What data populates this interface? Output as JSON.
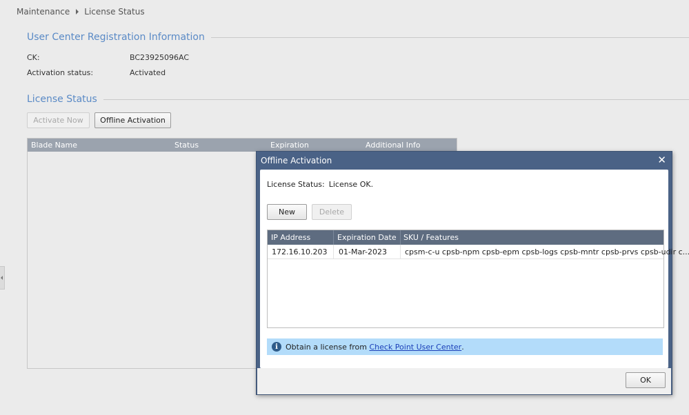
{
  "breadcrumb": {
    "parent": "Maintenance",
    "current": "License Status"
  },
  "registration": {
    "title": "User Center Registration Information",
    "ck_label": "CK:",
    "ck_value": "BC23925096AC",
    "activation_label": "Activation status:",
    "activation_value": "Activated"
  },
  "license": {
    "title": "License Status",
    "activate_now": "Activate Now",
    "offline_activation": "Offline Activation",
    "columns": [
      "Blade Name",
      "Status",
      "Expiration",
      "Additional Info"
    ]
  },
  "dialog": {
    "title": "Offline Activation",
    "status_label": "License Status:",
    "status_value": "License OK.",
    "new_label": "New",
    "delete_label": "Delete",
    "columns": [
      "IP Address",
      "Expiration Date",
      "SKU / Features"
    ],
    "rows": [
      {
        "ip": "172.16.10.203",
        "expiration": "01-Mar-2023",
        "sku": "cpsm-c-u cpsb-npm cpsb-epm cpsb-logs cpsb-mntr cpsb-prvs cpsb-udir c..."
      }
    ],
    "info_text": "Obtain a license from",
    "info_link": "Check Point User Center",
    "info_suffix": ".",
    "ok_label": "OK"
  },
  "colors": {
    "accent": "#5a8ac6",
    "dialog_frame": "#4a6286",
    "info_bar": "#b3dcfa"
  }
}
